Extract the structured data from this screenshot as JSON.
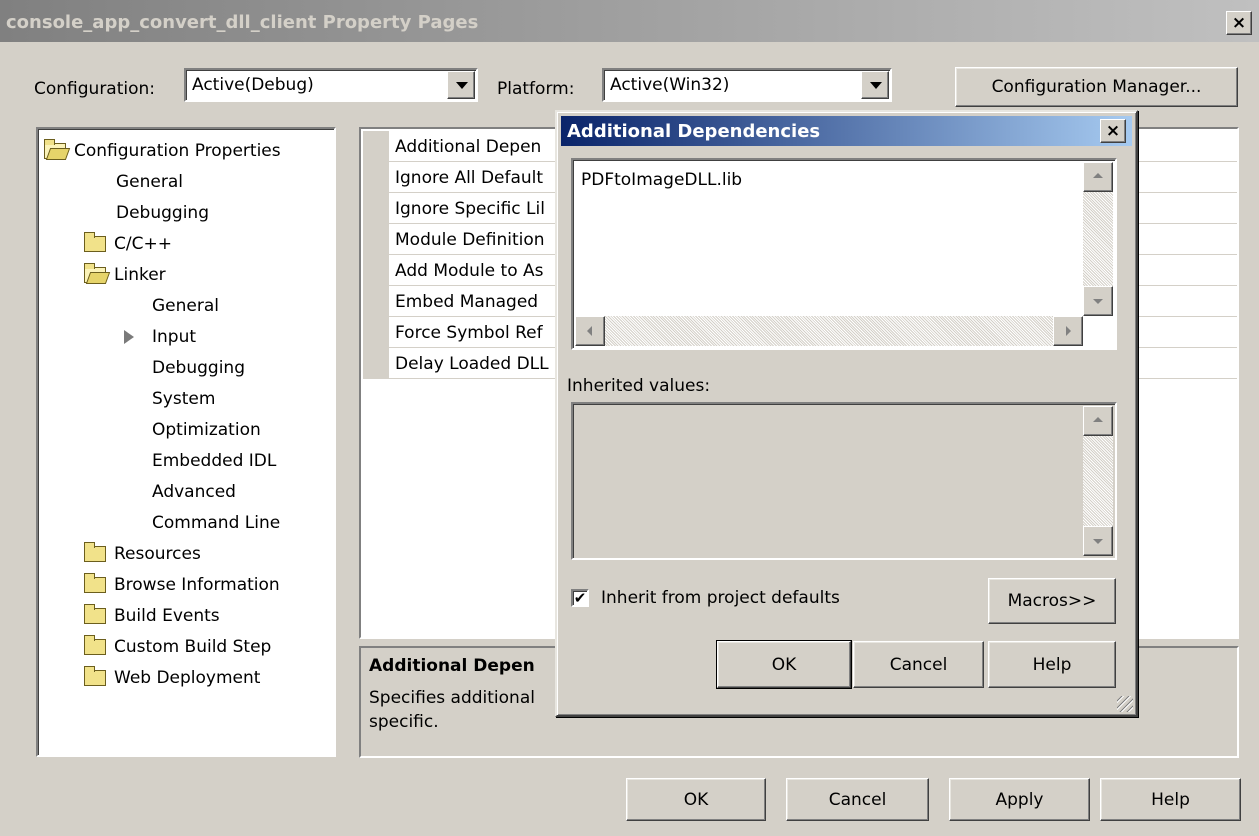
{
  "window": {
    "title": "console_app_convert_dll_client Property Pages",
    "close": "×"
  },
  "toolbar": {
    "configuration_label": "Configuration:",
    "configuration_value": "Active(Debug)",
    "platform_label": "Platform:",
    "platform_value": "Active(Win32)",
    "config_manager_label": "Configuration Manager..."
  },
  "tree": {
    "root": "Configuration Properties",
    "general": "General",
    "debugging": "Debugging",
    "cpp": "C/C++",
    "linker": "Linker",
    "linker_items": [
      "General",
      "Input",
      "Debugging",
      "System",
      "Optimization",
      "Embedded IDL",
      "Advanced",
      "Command Line"
    ],
    "resources": "Resources",
    "browse": "Browse Information",
    "build_events": "Build Events",
    "custom_build": "Custom Build Step",
    "web_deployment": "Web Deployment"
  },
  "grid": {
    "rows": [
      "Additional Depen",
      "Ignore All Default",
      "Ignore Specific Lil",
      "Module Definition",
      "Add Module to As",
      "Embed Managed",
      "Force Symbol Ref",
      "Delay Loaded DLL"
    ]
  },
  "description": {
    "title": "Additional Depen",
    "text_line1": "Specifies additional",
    "text_line2": "specific."
  },
  "dialog": {
    "title": "Additional Dependencies",
    "close": "×",
    "edit_value": "PDFtoImageDLL.lib",
    "inherited_label": "Inherited values:",
    "inherit_checkbox_label": "Inherit from project defaults",
    "inherit_checked": true,
    "check_mark": "✔",
    "macros_button": "Macros>>",
    "ok_button": "OK",
    "cancel_button": "Cancel",
    "help_button": "Help"
  },
  "footer": {
    "ok": "OK",
    "cancel": "Cancel",
    "apply": "Apply",
    "help": "Help"
  },
  "icons": {
    "folder": "folder-icon",
    "folder_open": "folder-open-icon",
    "selection_arrow": "arrow-right-icon"
  }
}
